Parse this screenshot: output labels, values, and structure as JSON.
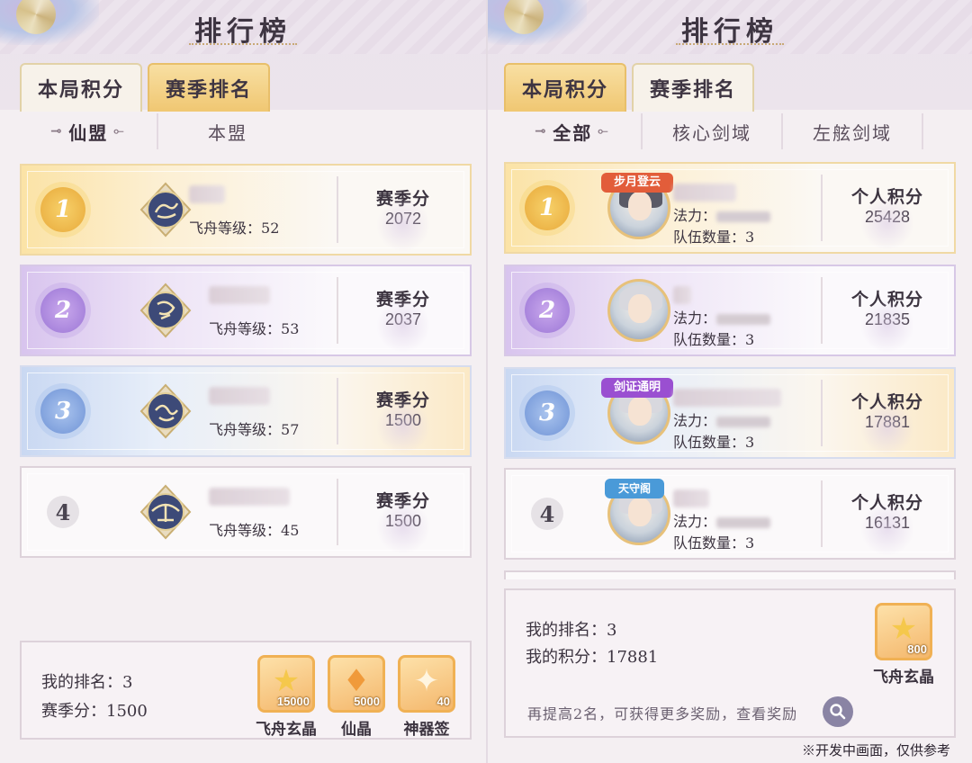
{
  "header": {
    "title": "排行榜"
  },
  "left": {
    "tabs": [
      "本局积分",
      "赛季排名"
    ],
    "subtabs": [
      "仙盟",
      "本盟"
    ],
    "rows": [
      {
        "rank": "1",
        "level_label": "飞舟等级：",
        "level": "52",
        "score_label": "赛季分",
        "score": "2072"
      },
      {
        "rank": "2",
        "level_label": "飞舟等级：",
        "level": "53",
        "score_label": "赛季分",
        "score": "2037"
      },
      {
        "rank": "3",
        "level_label": "飞舟等级：",
        "level": "57",
        "score_label": "赛季分",
        "score": "1500"
      },
      {
        "rank": "4",
        "level_label": "飞舟等级：",
        "level": "45",
        "score_label": "赛季分",
        "score": "1500"
      }
    ],
    "footer": {
      "my_rank_label": "我的排名：",
      "my_rank": "3",
      "score_label": "赛季分：",
      "score": "1500",
      "rewards": [
        {
          "name": "飞舟玄晶",
          "qty": "15000",
          "icon": "star-crystal-icon"
        },
        {
          "name": "仙晶",
          "qty": "5000",
          "icon": "flame-crystal-icon"
        },
        {
          "name": "神器签",
          "qty": "40",
          "icon": "artifact-token-icon"
        }
      ]
    }
  },
  "right": {
    "tabs": [
      "本局积分",
      "赛季排名"
    ],
    "subtabs": [
      "全部",
      "核心剑域",
      "左舷剑域"
    ],
    "rows": [
      {
        "rank": "1",
        "badge": "步月登云",
        "power_label": "法力：",
        "team_label": "队伍数量：",
        "team": "3",
        "score_label": "个人积分",
        "score": "25428"
      },
      {
        "rank": "2",
        "badge": "",
        "power_label": "法力：",
        "team_label": "队伍数量：",
        "team": "3",
        "score_label": "个人积分",
        "score": "21835"
      },
      {
        "rank": "3",
        "badge": "剑证通明",
        "power_label": "法力：",
        "team_label": "队伍数量：",
        "team": "3",
        "score_label": "个人积分",
        "score": "17881"
      },
      {
        "rank": "4",
        "badge": "天守阁",
        "power_label": "法力：",
        "team_label": "队伍数量：",
        "team": "3",
        "score_label": "个人积分",
        "score": "16131"
      }
    ],
    "footer": {
      "my_rank_label": "我的排名：",
      "my_rank": "3",
      "score_label": "我的积分：",
      "score": "17881",
      "reward": {
        "name": "飞舟玄晶",
        "qty": "800",
        "icon": "star-crystal-icon"
      },
      "hint": "再提高2名，可获得更多奖励，查看奖励"
    }
  },
  "disclaimer": "※开发中画面，仅供参考",
  "colors": {
    "gold": "#f0c772",
    "purple": "#9b76d6",
    "blue": "#6f93d6"
  }
}
